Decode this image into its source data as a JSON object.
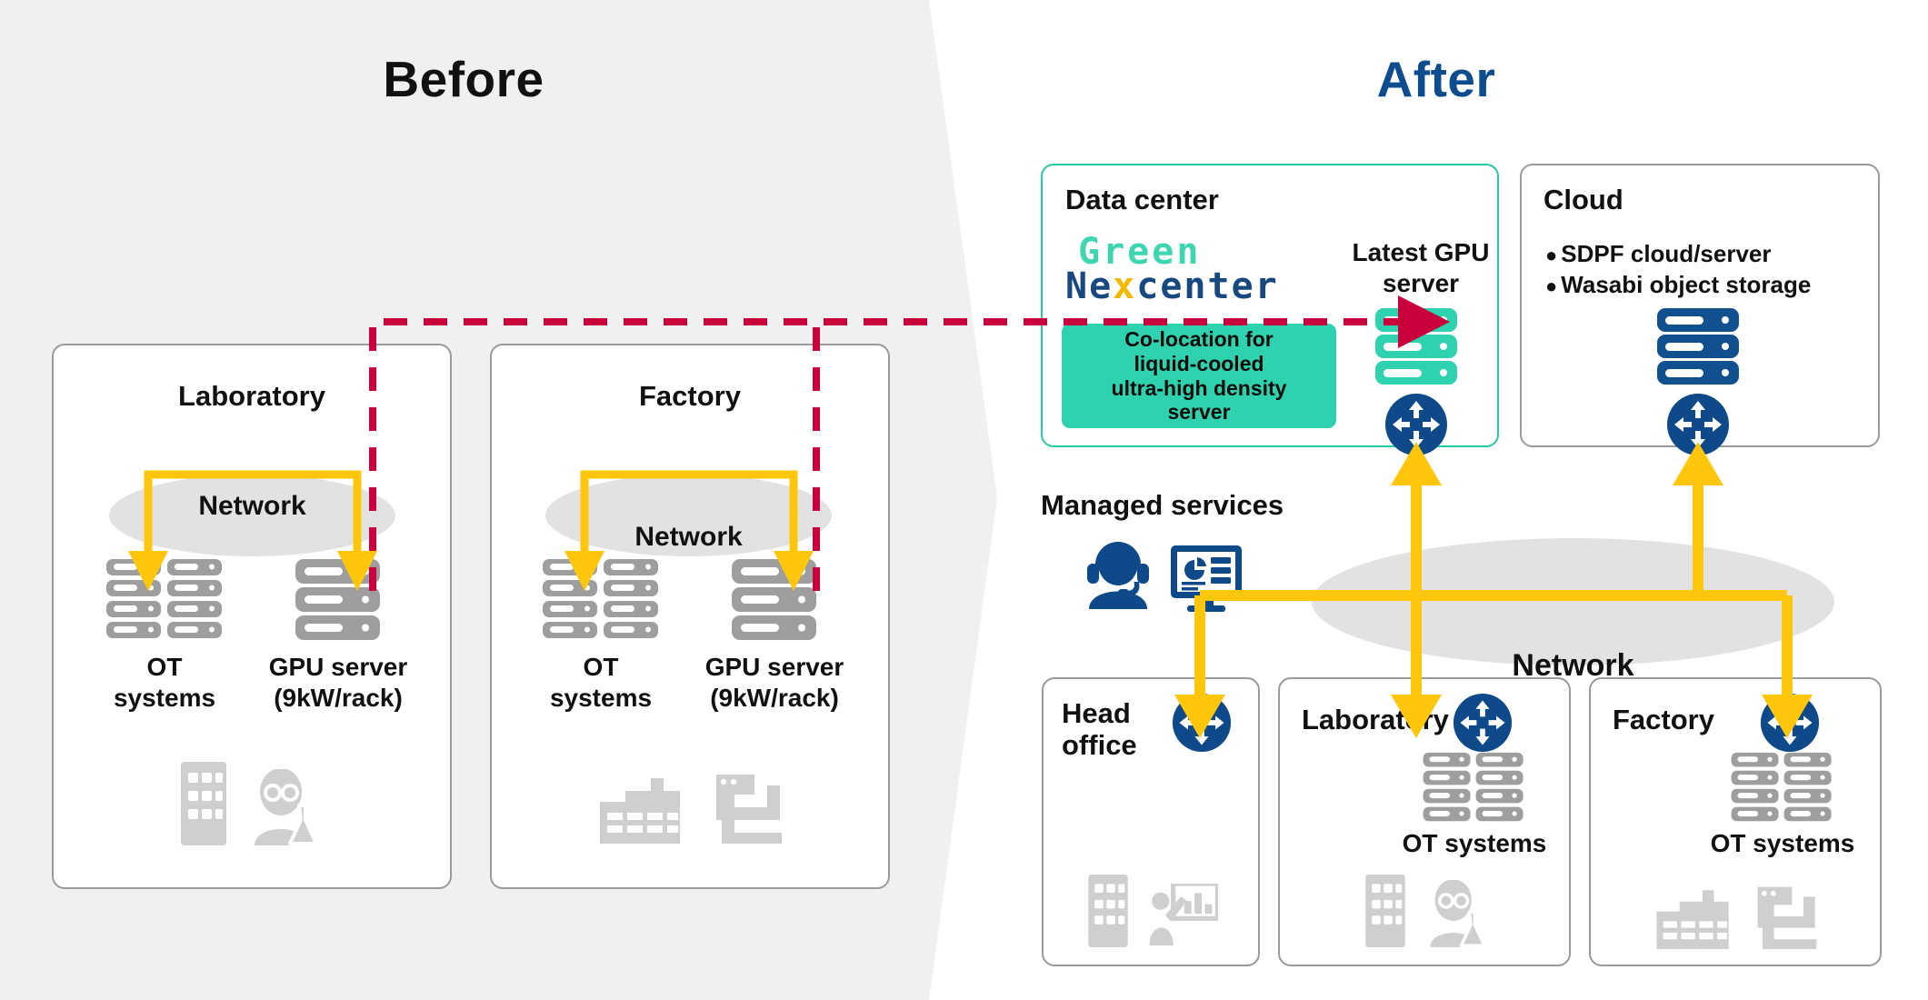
{
  "titles": {
    "before": "Before",
    "after": "After"
  },
  "colors": {
    "panel_gray": "#f0f0f0",
    "accent_navy": "#0d4c8e",
    "accent_teal": "#2ed2af",
    "logo_green": "#3dd6b0",
    "logo_navy": "#17487f",
    "logo_x_yellow": "#f5b800",
    "arrow_yellow": "#ffc60b",
    "dashed_red": "#c8003c",
    "icon_gray": "#9e9e9e",
    "ellipse_gray": "#e2e2e2",
    "card_border": "#9a9a9a"
  },
  "before": {
    "boxes": [
      {
        "title": "Laboratory",
        "network_label": "Network",
        "left_label": "OT\nsystems",
        "left_label_line1": "OT",
        "left_label_line2": "systems",
        "right_label_line1": "GPU server",
        "right_label_line2": "(9kW/rack)",
        "footer_icons": [
          "building-icon",
          "scientist-icon"
        ]
      },
      {
        "title": "Factory",
        "network_label": "Network",
        "left_label_line1": "OT",
        "left_label_line2": "systems",
        "right_label_line1": "GPU server",
        "right_label_line2": "(9kW/rack)",
        "footer_icons": [
          "factory-icon",
          "machine-icon"
        ]
      }
    ]
  },
  "after": {
    "datacenter": {
      "title": "Data center",
      "logo_line1": "Green",
      "logo_line2_a": "Ne",
      "logo_line2_x": "x",
      "logo_line2_b": "center",
      "colocation_text": "Co-location for liquid-cooled ultra-high density server",
      "colocation_lines": [
        "Co-location for",
        "liquid-cooled",
        "ultra-high density",
        "server"
      ],
      "server_label_line1": "Latest GPU",
      "server_label_line2": "server",
      "server_icon": "gpu-server-icon",
      "router_icon": "router-icon"
    },
    "cloud": {
      "title": "Cloud",
      "bullets": [
        "SDPF cloud/server",
        "Wasabi object storage"
      ],
      "server_icon": "cloud-server-icon",
      "router_icon": "router-icon"
    },
    "managed_services": {
      "title": "Managed services",
      "icons": [
        "headset-operator-icon",
        "dashboard-monitor-icon"
      ]
    },
    "network_label": "Network",
    "sites": [
      {
        "title_line1": "Head",
        "title_line2": "office",
        "title": "Head office",
        "ot_label": "",
        "has_ot": false,
        "router_icon": "router-icon",
        "footer_icons": [
          "building-icon",
          "presenter-icon"
        ]
      },
      {
        "title": "Laboratory",
        "title_line1": "Laboratory",
        "title_line2": "",
        "ot_label": "OT systems",
        "has_ot": true,
        "router_icon": "router-icon",
        "footer_icons": [
          "building-icon",
          "scientist-icon"
        ]
      },
      {
        "title": "Factory",
        "title_line1": "Factory",
        "title_line2": "",
        "ot_label": "OT systems",
        "has_ot": true,
        "router_icon": "router-icon",
        "footer_icons": [
          "factory-icon",
          "machine-icon"
        ]
      }
    ]
  }
}
